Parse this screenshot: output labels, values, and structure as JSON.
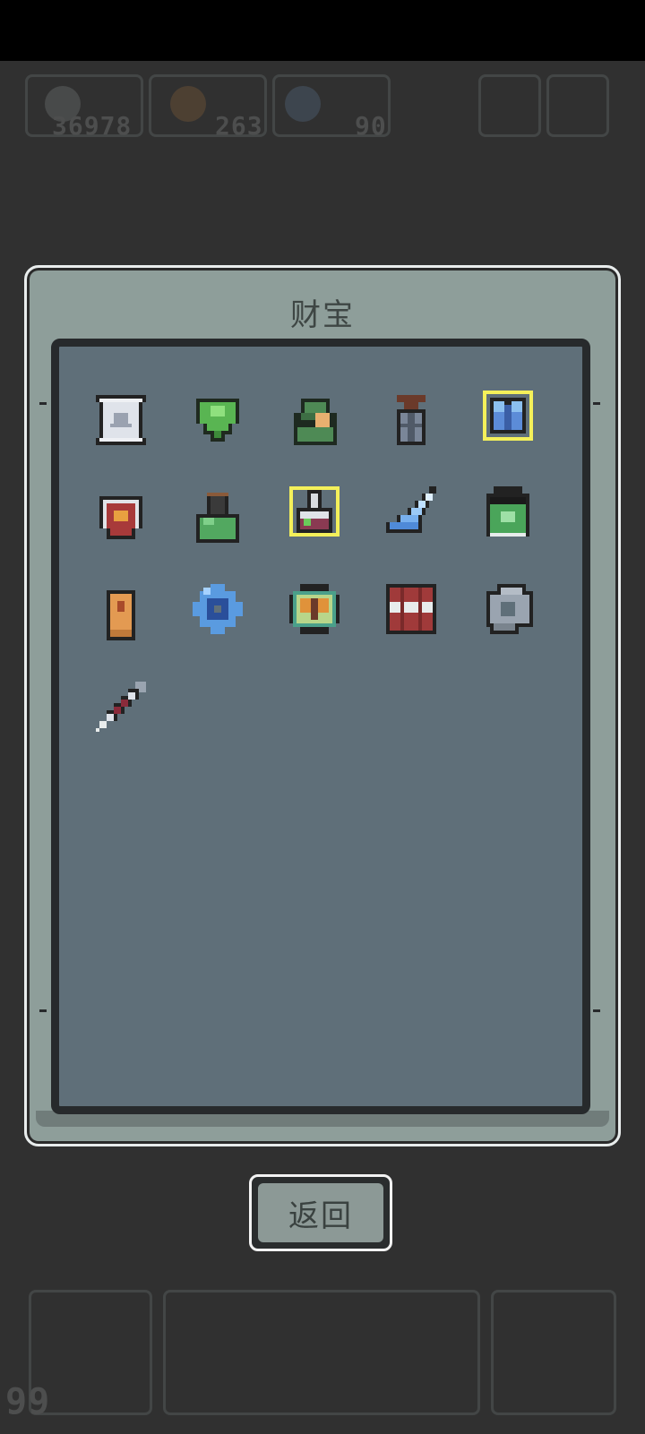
{
  "hud": {
    "soul_count": "36978",
    "fire_count": "263",
    "crystal_count": "90",
    "level_count": "99"
  },
  "modal": {
    "title": "财宝",
    "back_label": "返回"
  },
  "treasures": [
    {
      "icon": "scroll-icon",
      "highlighted": false
    },
    {
      "icon": "green-gem-icon",
      "highlighted": false
    },
    {
      "icon": "soldier-helmet-icon",
      "highlighted": false
    },
    {
      "icon": "grenade-icon",
      "highlighted": false
    },
    {
      "icon": "blue-armor-icon",
      "highlighted": true
    },
    {
      "icon": "red-shield-icon",
      "highlighted": false
    },
    {
      "icon": "green-flask-icon",
      "highlighted": false
    },
    {
      "icon": "potion-flask-icon",
      "highlighted": true
    },
    {
      "icon": "ice-shard-icon",
      "highlighted": false
    },
    {
      "icon": "green-battery-icon",
      "highlighted": false
    },
    {
      "icon": "bullet-icon",
      "highlighted": false
    },
    {
      "icon": "blue-gear-icon",
      "highlighted": false
    },
    {
      "icon": "butterfly-medal-icon",
      "highlighted": false
    },
    {
      "icon": "red-crate-icon",
      "highlighted": false
    },
    {
      "icon": "steel-nut-icon",
      "highlighted": false
    },
    {
      "icon": "syringe-icon",
      "highlighted": false
    }
  ],
  "colors": {
    "highlight": "#f4f05a",
    "panel": "#5f6f79",
    "frame": "#8e9e9a"
  }
}
